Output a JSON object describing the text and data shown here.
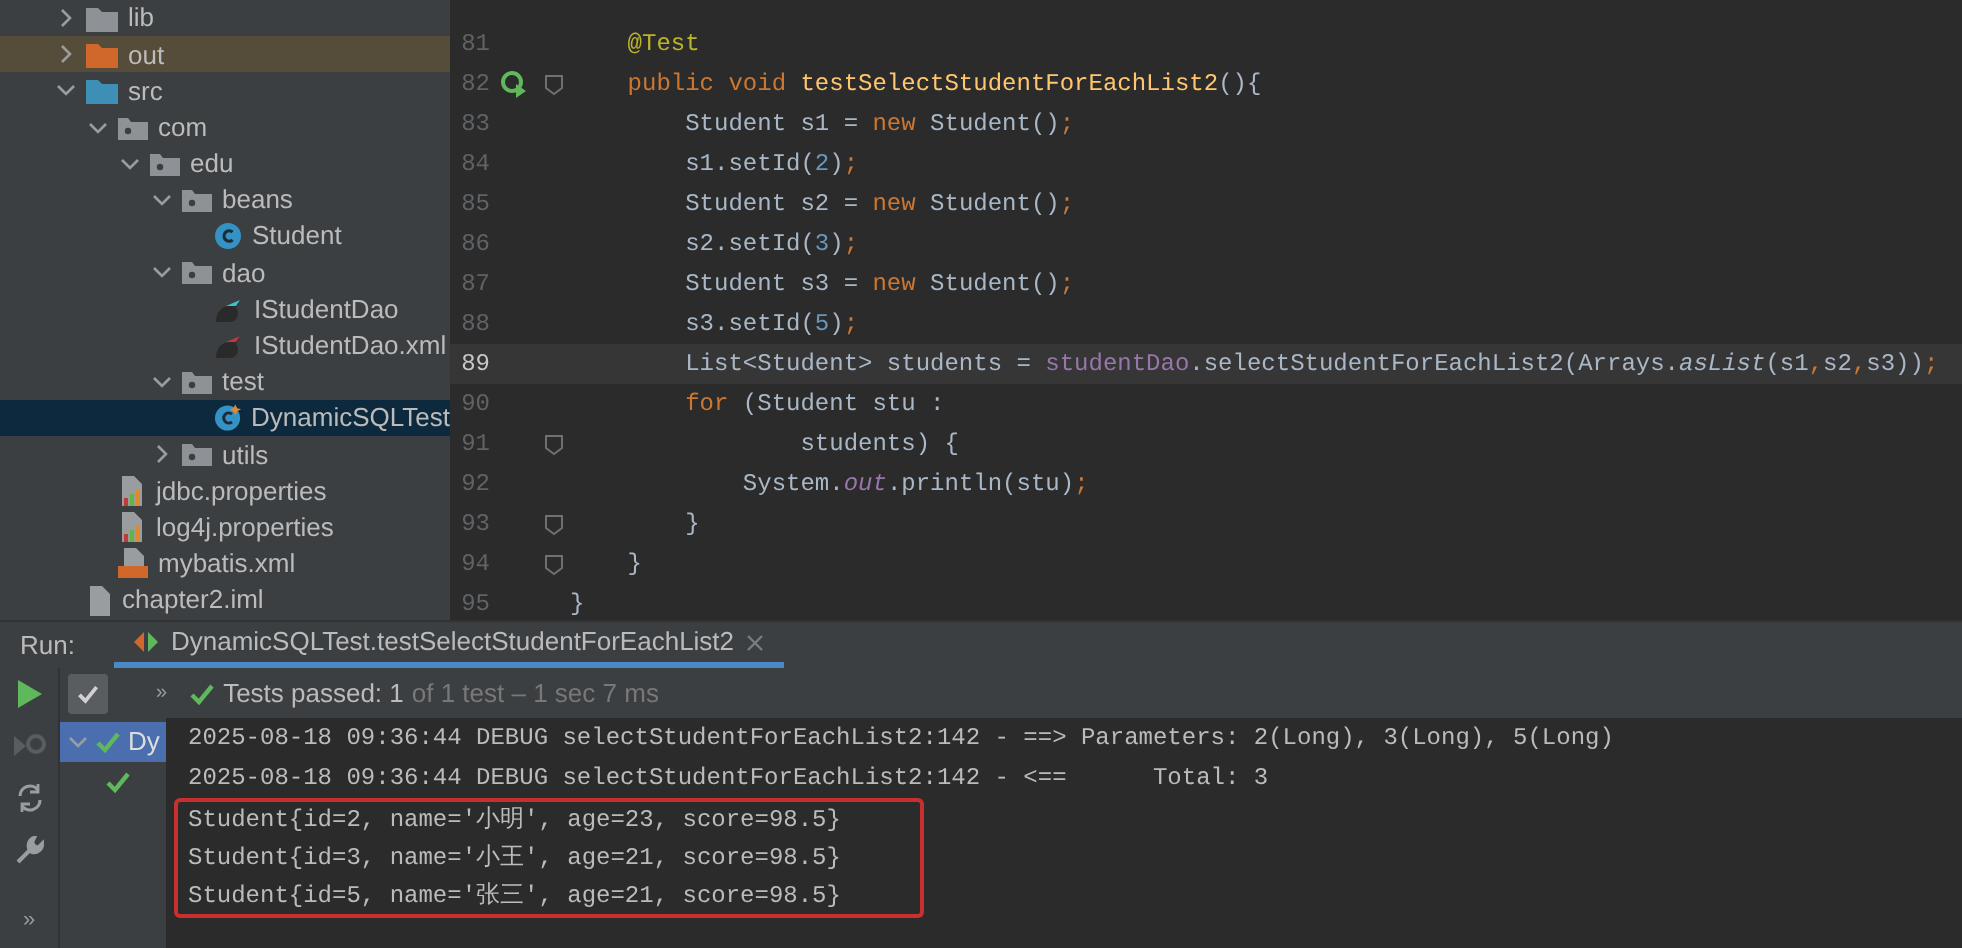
{
  "project_tree": [
    {
      "label": "lib",
      "kind": "folder",
      "expanded": false,
      "selected": false,
      "hovered": false
    },
    {
      "label": "out",
      "kind": "folder-excluded",
      "expanded": false,
      "selected": false,
      "hovered": true
    },
    {
      "label": "src",
      "kind": "folder-source",
      "expanded": true,
      "selected": false,
      "hovered": false,
      "children": [
        {
          "label": "com",
          "kind": "package",
          "expanded": true,
          "selected": false,
          "hovered": false,
          "children": [
            {
              "label": "edu",
              "kind": "package",
              "expanded": true,
              "selected": false,
              "hovered": false,
              "children": [
                {
                  "label": "beans",
                  "kind": "package",
                  "expanded": true,
                  "selected": false,
                  "hovered": false,
                  "children": [
                    {
                      "label": "Student",
                      "kind": "class",
                      "selected": false,
                      "hovered": false
                    }
                  ]
                },
                {
                  "label": "dao",
                  "kind": "package",
                  "expanded": true,
                  "selected": false,
                  "hovered": false,
                  "children": [
                    {
                      "label": "IStudentDao",
                      "kind": "mapper",
                      "selected": false,
                      "hovered": false
                    },
                    {
                      "label": "IStudentDao.xml",
                      "kind": "mapper-xml",
                      "selected": false,
                      "hovered": false
                    }
                  ]
                },
                {
                  "label": "test",
                  "kind": "package",
                  "expanded": true,
                  "selected": false,
                  "hovered": false,
                  "children": [
                    {
                      "label": "DynamicSQLTest",
                      "kind": "test-class",
                      "selected": true,
                      "hovered": false
                    }
                  ]
                },
                {
                  "label": "utils",
                  "kind": "package",
                  "expanded": false,
                  "selected": false,
                  "hovered": false
                }
              ]
            }
          ]
        },
        {
          "label": "jdbc.properties",
          "kind": "properties",
          "selected": false,
          "hovered": false
        },
        {
          "label": "log4j.properties",
          "kind": "properties",
          "selected": false,
          "hovered": false
        },
        {
          "label": "mybatis.xml",
          "kind": "xml",
          "selected": false,
          "hovered": false
        }
      ]
    },
    {
      "label": "chapter2.iml",
      "kind": "file",
      "selected": false,
      "hovered": false
    }
  ],
  "editor": {
    "lines": [
      {
        "number": "81",
        "current": false,
        "run_icon": false,
        "fold_marker": false,
        "segments": [
          {
            "text": "    @Test",
            "kind": "annotation"
          }
        ]
      },
      {
        "number": "82",
        "current": false,
        "run_icon": true,
        "fold_marker": true,
        "segments": [
          {
            "text": "    public void ",
            "kind": "keyword"
          },
          {
            "text": "testSelectStudentForEachList2",
            "kind": "declaration"
          },
          {
            "text": "(){",
            "kind": "plain"
          }
        ]
      },
      {
        "number": "83",
        "current": false,
        "run_icon": false,
        "fold_marker": false,
        "segments": [
          {
            "text": "        Student s1 = ",
            "kind": "plain"
          },
          {
            "text": "new ",
            "kind": "keyword"
          },
          {
            "text": "Student()",
            "kind": "plain"
          },
          {
            "text": ";",
            "kind": "keyword"
          }
        ]
      },
      {
        "number": "84",
        "current": false,
        "run_icon": false,
        "fold_marker": false,
        "segments": [
          {
            "text": "        s1.setId(",
            "kind": "plain"
          },
          {
            "text": "2",
            "kind": "number"
          },
          {
            "text": ")",
            "kind": "plain"
          },
          {
            "text": ";",
            "kind": "keyword"
          }
        ]
      },
      {
        "number": "85",
        "current": false,
        "run_icon": false,
        "fold_marker": false,
        "segments": [
          {
            "text": "        Student s2 = ",
            "kind": "plain"
          },
          {
            "text": "new ",
            "kind": "keyword"
          },
          {
            "text": "Student()",
            "kind": "plain"
          },
          {
            "text": ";",
            "kind": "keyword"
          }
        ]
      },
      {
        "number": "86",
        "current": false,
        "run_icon": false,
        "fold_marker": false,
        "segments": [
          {
            "text": "        s2.setId(",
            "kind": "plain"
          },
          {
            "text": "3",
            "kind": "number"
          },
          {
            "text": ")",
            "kind": "plain"
          },
          {
            "text": ";",
            "kind": "keyword"
          }
        ]
      },
      {
        "number": "87",
        "current": false,
        "run_icon": false,
        "fold_marker": false,
        "segments": [
          {
            "text": "        Student s3 = ",
            "kind": "plain"
          },
          {
            "text": "new ",
            "kind": "keyword"
          },
          {
            "text": "Student()",
            "kind": "plain"
          },
          {
            "text": ";",
            "kind": "keyword"
          }
        ]
      },
      {
        "number": "88",
        "current": false,
        "run_icon": false,
        "fold_marker": false,
        "segments": [
          {
            "text": "        s3.setId(",
            "kind": "plain"
          },
          {
            "text": "5",
            "kind": "number"
          },
          {
            "text": ")",
            "kind": "plain"
          },
          {
            "text": ";",
            "kind": "keyword"
          }
        ]
      },
      {
        "number": "89",
        "current": true,
        "run_icon": false,
        "fold_marker": false,
        "segments": [
          {
            "text": "        List<Student> students = ",
            "kind": "plain"
          },
          {
            "text": "studentDao",
            "kind": "field"
          },
          {
            "text": ".selectStudentForEachList2(Arrays.",
            "kind": "plain"
          },
          {
            "text": "asList",
            "kind": "static"
          },
          {
            "text": "(s1",
            "kind": "plain"
          },
          {
            "text": ",",
            "kind": "keyword"
          },
          {
            "text": "s2",
            "kind": "plain"
          },
          {
            "text": ",",
            "kind": "keyword"
          },
          {
            "text": "s3))",
            "kind": "plain"
          },
          {
            "text": ";",
            "kind": "keyword"
          }
        ]
      },
      {
        "number": "90",
        "current": false,
        "run_icon": false,
        "fold_marker": false,
        "segments": [
          {
            "text": "        for ",
            "kind": "keyword"
          },
          {
            "text": "(Student stu :",
            "kind": "plain"
          }
        ]
      },
      {
        "number": "91",
        "current": false,
        "run_icon": false,
        "fold_marker": true,
        "segments": [
          {
            "text": "                students) {",
            "kind": "plain"
          }
        ]
      },
      {
        "number": "92",
        "current": false,
        "run_icon": false,
        "fold_marker": false,
        "segments": [
          {
            "text": "            System.",
            "kind": "plain"
          },
          {
            "text": "out",
            "kind": "static-field"
          },
          {
            "text": ".println(stu)",
            "kind": "plain"
          },
          {
            "text": ";",
            "kind": "keyword"
          }
        ]
      },
      {
        "number": "93",
        "current": false,
        "run_icon": false,
        "fold_marker": true,
        "segments": [
          {
            "text": "        }",
            "kind": "plain"
          }
        ]
      },
      {
        "number": "94",
        "current": false,
        "run_icon": false,
        "fold_marker": true,
        "segments": [
          {
            "text": "    }",
            "kind": "plain"
          }
        ]
      },
      {
        "number": "95",
        "current": false,
        "run_icon": false,
        "fold_marker": false,
        "segments": [
          {
            "text": "}",
            "kind": "plain"
          }
        ]
      }
    ]
  },
  "run_panel": {
    "label": "Run:",
    "tab": {
      "title": "DynamicSQLTest.testSelectStudentForEachList2",
      "selected": true
    },
    "toolbar": {
      "show_passed": {
        "checked": true
      },
      "more": "»",
      "status_bold": "Tests passed: 1",
      "status_rest": "of 1 test – 1 sec 7 ms"
    },
    "side_more": "»",
    "test_tree": [
      {
        "label": "Dy",
        "selected": true,
        "passed": true,
        "expanded": true
      },
      {
        "selected": false,
        "passed": true
      }
    ],
    "console": [
      {
        "text": "2025-08-18 09:36:44 DEBUG selectStudentForEachList2:142 - ==> Parameters: 2(Long), 3(Long), 5(Long)",
        "highlighted": false
      },
      {
        "text": "2025-08-18 09:36:44 DEBUG selectStudentForEachList2:142 - <==      Total: 3",
        "highlighted": false
      },
      {
        "text": "Student{id=2, name='小明', age=23, score=98.5}",
        "highlighted": true
      },
      {
        "text": "Student{id=3, name='小王', age=21, score=98.5}",
        "highlighted": true
      },
      {
        "text": "Student{id=5, name='张三', age=21, score=98.5}",
        "highlighted": true
      }
    ]
  }
}
